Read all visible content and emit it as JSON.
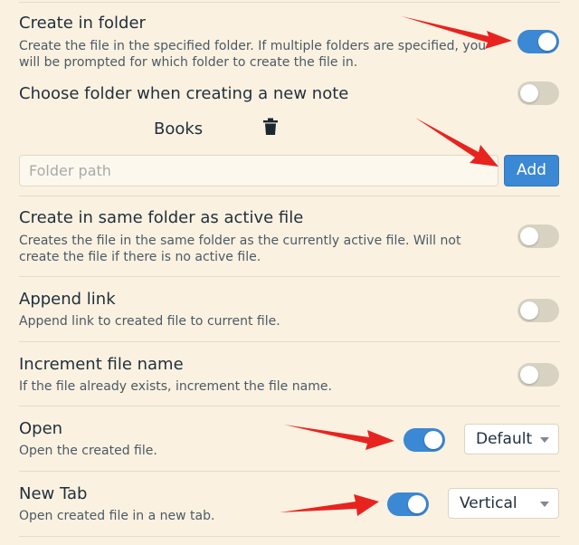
{
  "settings": {
    "create_in_folder": {
      "title": "Create in folder",
      "description": "Create the file in the specified folder. If multiple folders are specified, you will be prompted for which folder to create the file in.",
      "enabled": true
    },
    "choose_folder": {
      "title": "Choose folder when creating a new note",
      "enabled": false
    },
    "folders": {
      "items": [
        "Books"
      ],
      "placeholder": "Folder path",
      "add_label": "Add"
    },
    "same_folder": {
      "title": "Create in same folder as active file",
      "description": "Creates the file in the same folder as the currently active file. Will not create the file if there is no active file.",
      "enabled": false
    },
    "append_link": {
      "title": "Append link",
      "description": "Append link to created file to current file.",
      "enabled": false
    },
    "increment": {
      "title": "Increment file name",
      "description": "If the file already exists, increment the file name.",
      "enabled": false
    },
    "open": {
      "title": "Open",
      "description": "Open the created file.",
      "enabled": true,
      "mode": "Default"
    },
    "new_tab": {
      "title": "New Tab",
      "description": "Open created file in a new tab.",
      "enabled": true,
      "direction": "Vertical"
    }
  },
  "colors": {
    "background": "#fbf1e0",
    "toggle_on": "#3b88d4",
    "toggle_off": "#d8d2c2",
    "annotation_arrow": "#e8231f"
  },
  "icons": [
    "trash-icon",
    "chevron-down-icon",
    "annotation-arrow"
  ]
}
